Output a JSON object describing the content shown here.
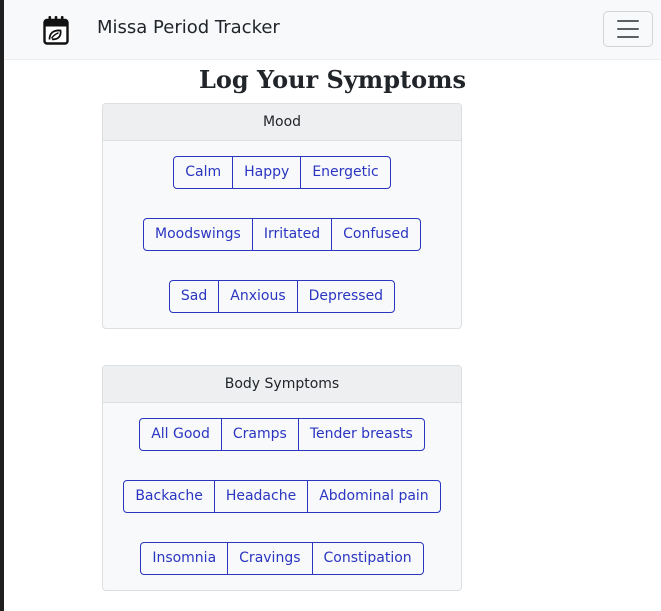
{
  "navbar": {
    "brand": "Missa Period Tracker",
    "brand_icon": "calendar-icon",
    "menu_icon": "hamburger-menu-icon"
  },
  "page": {
    "title": "Log Your Symptoms"
  },
  "mood": {
    "header": "Mood",
    "rows": [
      [
        "Calm",
        "Happy",
        "Energetic"
      ],
      [
        "Moodswings",
        "Irritated",
        "Confused"
      ],
      [
        "Sad",
        "Anxious",
        "Depressed"
      ]
    ]
  },
  "body_symptoms": {
    "header": "Body Symptoms",
    "rows": [
      [
        "All Good",
        "Cramps",
        "Tender breasts"
      ],
      [
        "Backache",
        "Headache",
        "Abdominal pain"
      ],
      [
        "Insomnia",
        "Cravings",
        "Constipation"
      ]
    ]
  },
  "colors": {
    "accent": "#2a35c2",
    "navbar_bg": "#f8f9fa",
    "card_header_bg": "#eeeff1"
  }
}
